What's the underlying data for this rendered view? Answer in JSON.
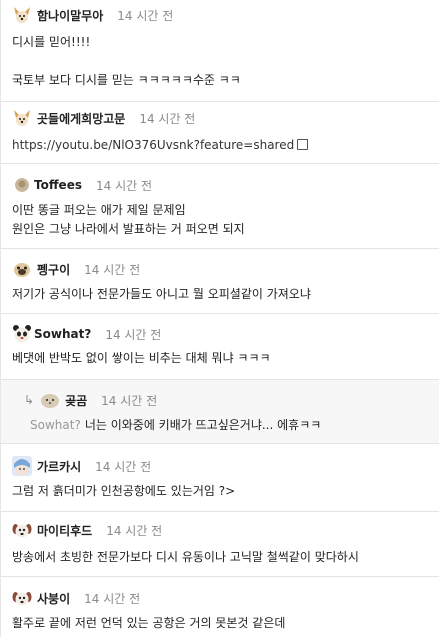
{
  "comments": [
    {
      "nick": "함나이말무아",
      "time": "14 시간 전",
      "avatar": "dog-avatar-icon",
      "lines": [
        "디시를 믿어!!!!",
        "",
        "국토부 보다 디시를 믿는 ㅋㅋㅋㅋㅋ수준 ㅋㅋ"
      ]
    },
    {
      "nick": "곳들에게희망고문",
      "time": "14 시간 전",
      "avatar": "dog-avatar-icon",
      "link": "https://youtu.be/NlO376Uvsnk?feature=shared"
    },
    {
      "nick": "Toffees",
      "time": "14 시간 전",
      "avatar": "round-avatar-icon",
      "lines": [
        "이딴 똥글 퍼오는 애가 제일 문제임",
        "원인은 그냥 나라에서 발표하는 거 퍼오면 되지"
      ]
    },
    {
      "nick": "펭구이",
      "time": "14 시간 전",
      "avatar": "pug-avatar-icon",
      "lines": [
        "저기가 공식이나 전문가들도 아니고 뭘 오피셜같이 가져오냐"
      ]
    },
    {
      "nick": "Sowhat?",
      "time": "14 시간 전",
      "avatar": "panda-avatar-icon",
      "lines": [
        "베댓에 반박도 없이 쌓이는 비추는 대체 뭐냐 ㅋㅋㅋ"
      ]
    },
    {
      "nick": "곶곰",
      "time": "14 시간 전",
      "avatar": "seal-avatar-icon",
      "reply": true,
      "mention": "Sowhat?",
      "lines": [
        "너는 이와중에 키배가 뜨고싶은거냐... 에휴ㅋㅋ"
      ]
    },
    {
      "nick": "가르카시",
      "time": "14 시간 전",
      "avatar": "anime-avatar-icon",
      "lines": [
        "그럼 저 흙더미가 인천공항에도 있는거임 ?>"
      ]
    },
    {
      "nick": "마이티후드",
      "time": "14 시간 전",
      "avatar": "puppy-avatar-icon",
      "lines": [
        "방송에서 초빙한 전문가보다 디시 유동이나 고닉말 철썩같이 맞다하시"
      ]
    },
    {
      "nick": "사붕이",
      "time": "14 시간 전",
      "avatar": "puppy-avatar-icon",
      "lines": [
        "활주로 끝에 저런 언덕 있는 공항은 거의 못본것 같은데"
      ]
    }
  ],
  "icons": {
    "external-link": "external-link-icon",
    "reply-arrow": "reply-arrow-icon"
  },
  "colors": {
    "time": "#8a8a8a",
    "divider": "#e4e4e4",
    "mention": "#999999",
    "reply_bg": "#f7f7f7"
  }
}
